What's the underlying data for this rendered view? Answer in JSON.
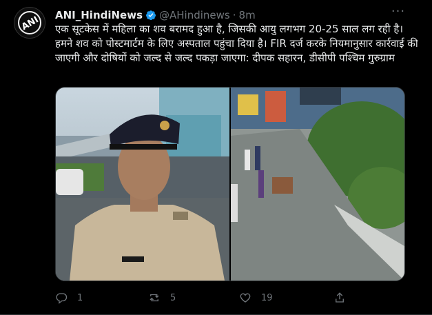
{
  "tweet": {
    "author_name": "ANI_HindiNews",
    "handle": "@AHindinews",
    "separator": "·",
    "time": "8m",
    "text": "एक सूटकेस में महिला का शव बरामद हुआ है, जिसकी आयु लगभग 20-25 साल लग रही है। हमने शव को पोस्टमार्टम के लिए अस्पताल पहुंचा दिया है। FIR दर्ज करके नियमानुसार कार्रवाई की जाएगी और दोषियों को जल्द से जल्द पकड़ा जाएगा: दीपक सहारन, डीसीपी पश्चिम गुरुग्राम",
    "avatar_logo_text": "ANI",
    "media": {
      "left_image": "officer-speaking-photo",
      "right_image": "road-scene-photo"
    },
    "actions": {
      "reply_count": "1",
      "retweet_count": "5",
      "like_count": "19"
    }
  },
  "colors": {
    "background": "#000000",
    "text": "#e7e9ea",
    "muted": "#71767b",
    "verified": "#1d9bf0"
  }
}
